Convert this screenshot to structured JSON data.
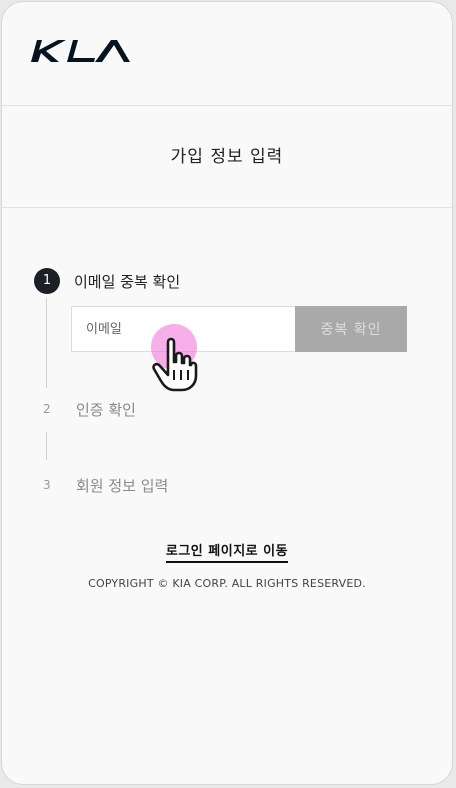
{
  "brand": {
    "logo_icon": "kia-logo",
    "color": "#05141f"
  },
  "page": {
    "title": "가입 정보 입력"
  },
  "steps": [
    {
      "number": "1",
      "label": "이메일 중복 확인",
      "state": "active"
    },
    {
      "number": "2",
      "label": "인증 확인",
      "state": "inactive"
    },
    {
      "number": "3",
      "label": "회원 정보 입력",
      "state": "inactive"
    }
  ],
  "email_form": {
    "placeholder": "이메일",
    "value": "",
    "check_button_label": "중복 확인"
  },
  "footer": {
    "login_link": "로그인 페이지로 이동",
    "copyright": "COPYRIGHT © KIA CORP. ALL RIGHTS RESERVED."
  },
  "colors": {
    "button_disabled": "#a9a9a9",
    "step_active": "#1c1f26",
    "touch_indicator": "#ee6ed6"
  }
}
